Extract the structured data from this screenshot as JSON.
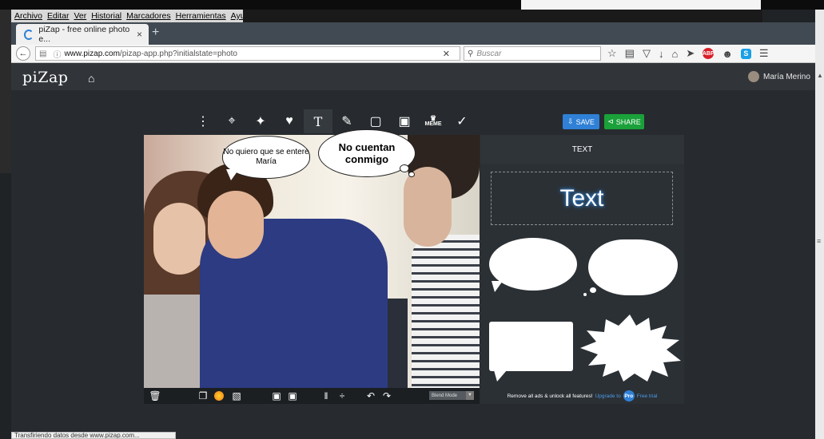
{
  "menubar": {
    "items": [
      "Archivo",
      "Editar",
      "Ver",
      "Historial",
      "Marcadores",
      "Herramientas",
      "Ayuda"
    ]
  },
  "tab": {
    "title": "piZap - free online photo e...",
    "close": "×",
    "new_tab": "+"
  },
  "nav": {
    "url_host": "www.pizap.com",
    "url_path": "/pizap-app.php?initialstate=photo",
    "search_placeholder": "Buscar",
    "abp_label": "ABP",
    "skype_label": "S"
  },
  "app": {
    "logo": "piZap",
    "user_name": "María Merino",
    "toolbar_meme_label": "MEME",
    "save_label": "SAVE",
    "share_label": "SHARE"
  },
  "photo": {
    "bubble1_text": "No quiero que se entere María",
    "bubble2_text": "No cuentan conmigo",
    "blend_mode_label": "Blend Mode"
  },
  "panel": {
    "title": "TEXT",
    "text_sample": "Text",
    "promo_text": "Remove all ads & unlock all features!",
    "promo_upgrade": "Upgrade to",
    "promo_pro": "Pro",
    "promo_trial": "Free trial"
  },
  "statusbar": {
    "text": "Transfiriendo datos desde www.pizap.com..."
  },
  "colors": {
    "accent_blue": "#2f80d6",
    "share_green": "#1aa13a",
    "app_bg": "#272b2f",
    "header_bg": "#31353a"
  },
  "icons": {
    "toolbar": [
      "more-vertical-icon",
      "crop-icon",
      "magic-wand-icon",
      "heart-icon",
      "text-icon",
      "paint-brush-icon",
      "frame-icon",
      "image-icon",
      "meme-icon",
      "eyedropper-icon"
    ],
    "photobar": [
      "trash-icon",
      "copy-icon",
      "color-icon",
      "gradient-icon",
      "layer-front-icon",
      "layer-back-icon",
      "flip-horizontal-icon",
      "flip-vertical-icon",
      "undo-icon",
      "redo-icon"
    ]
  }
}
